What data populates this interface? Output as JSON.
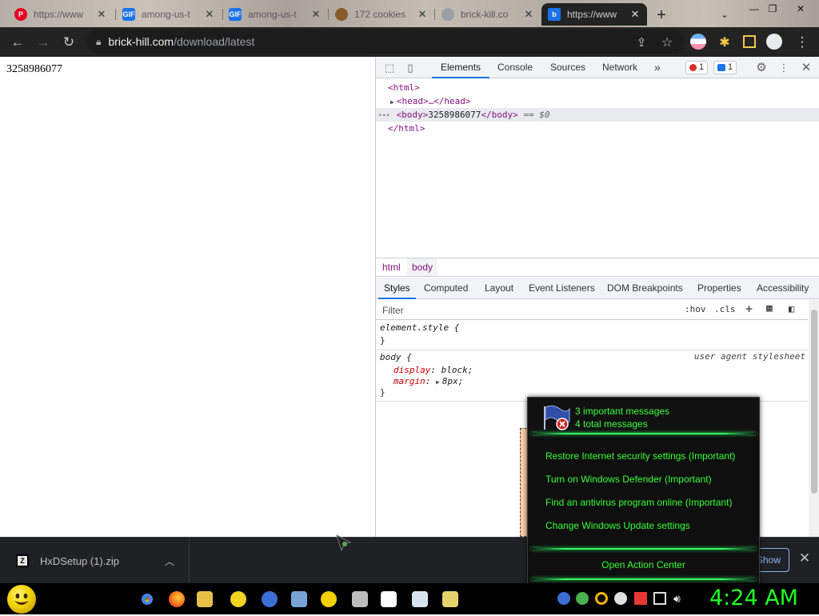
{
  "browser": {
    "tabs": [
      {
        "title": "https://www",
        "icon": "pinterest-icon",
        "color": "#e60023"
      },
      {
        "title": "among-us-t",
        "icon": "gif-icon",
        "color": "#1a73e8"
      },
      {
        "title": "among-us-t",
        "icon": "gif-icon",
        "color": "#1a73e8"
      },
      {
        "title": "172 cookies",
        "icon": "cookie-icon",
        "color": "#8a5a2b"
      },
      {
        "title": "brick-kill.co",
        "icon": "globe-icon",
        "color": "#9aa0a6"
      },
      {
        "title": "https://www",
        "icon": "brick-hill-icon",
        "color": "#1a73e8"
      }
    ],
    "url_host": "brick-hill.com",
    "url_path": "/download/latest"
  },
  "page": {
    "body_text": "3258986077"
  },
  "devtools": {
    "tabs": [
      "Elements",
      "Console",
      "Sources",
      "Network"
    ],
    "more": "»",
    "error_count": "1",
    "message_count": "1",
    "dom": {
      "html_open": "<html>",
      "head": "<head>…</head>",
      "body_open": "<body>",
      "body_text": "3258986077",
      "body_close": "</body>",
      "eq": "== $0",
      "html_close": "</html>",
      "dots": "•••"
    },
    "breadcrumbs": [
      "html",
      "body"
    ],
    "sub_tabs": [
      "Styles",
      "Computed",
      "Layout",
      "Event Listeners",
      "DOM Breakpoints",
      "Properties",
      "Accessibility"
    ],
    "filter_placeholder": "Filter",
    "hov": ":hov",
    "cls": ".cls",
    "plus": "+",
    "rules": {
      "element_style": "element.style {",
      "close": "}",
      "body_sel": "body {",
      "ua": "user agent stylesheet",
      "display_prop": "display",
      "display_val": "block;",
      "margin_prop": "margin",
      "margin_val": "8px;"
    }
  },
  "download": {
    "filename": "HxDSetup (1).zip",
    "show_all": "Show all"
  },
  "action_center": {
    "important": "3 important messages",
    "total": "4 total messages",
    "items": [
      "Restore Internet security settings (Important)",
      "Turn on Windows Defender (Important)",
      "Find an antivirus program online (Important)",
      "Change Windows Update settings"
    ],
    "open_button": "Open Action Center"
  },
  "taskbar": {
    "clock": "4:24 AM"
  },
  "colors": {
    "accent_green": "#37ff37",
    "devtools_blue": "#1a73e8",
    "tag_purple": "#881280"
  }
}
